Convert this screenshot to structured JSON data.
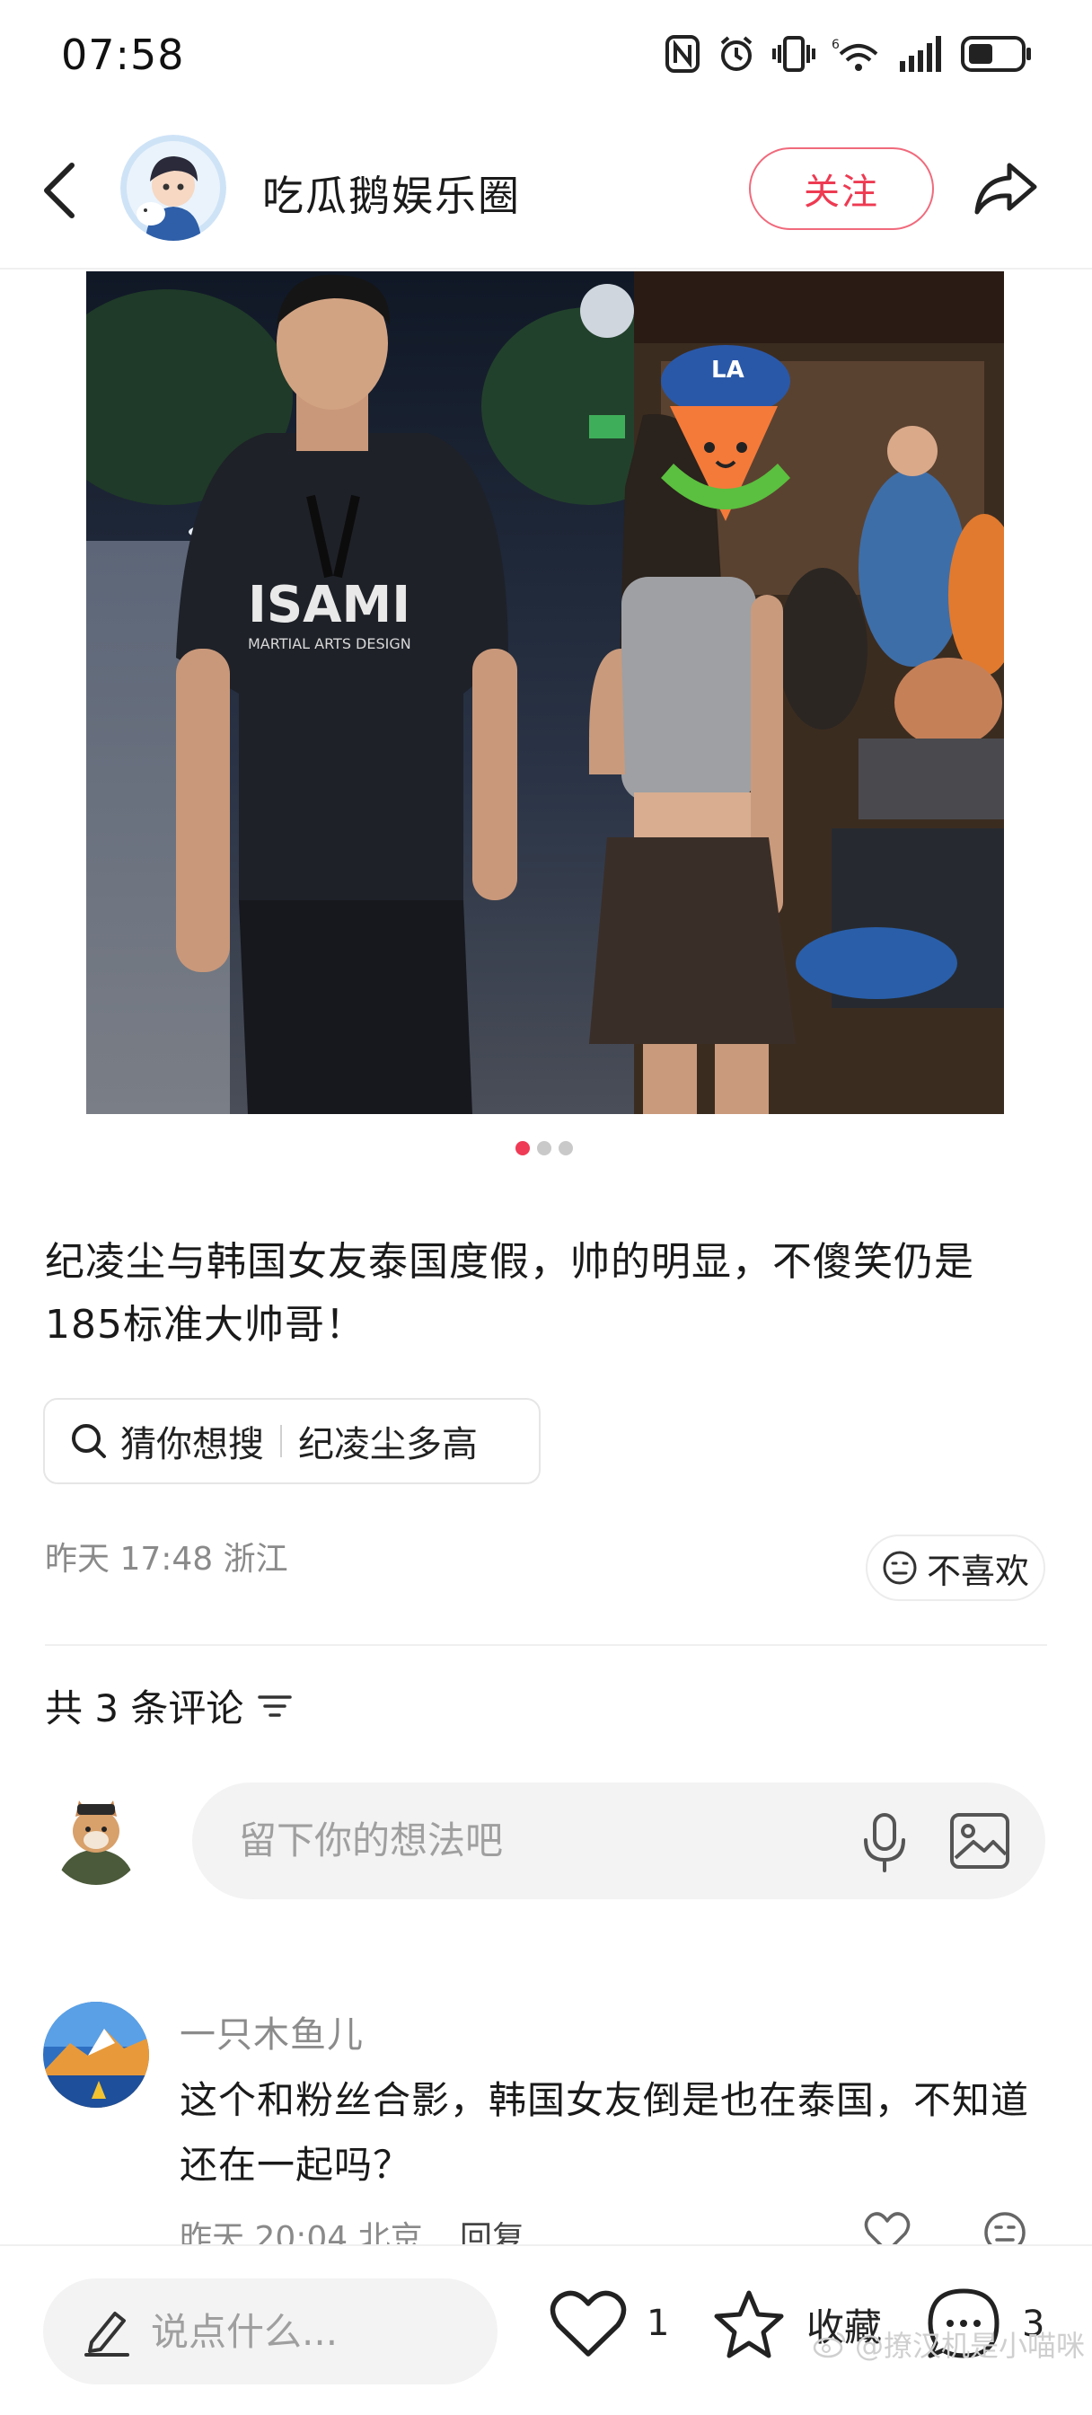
{
  "status_bar": {
    "time": "07:58",
    "icons": [
      "nfc-icon",
      "alarm-icon",
      "vibrate-icon",
      "wifi-6-icon",
      "signal-icon",
      "battery-icon"
    ]
  },
  "header": {
    "account_name": "吃瓜鹅娱乐圈",
    "follow_label": "关注"
  },
  "gallery": {
    "photo_shirt_text": "ISAMI",
    "photo_shirt_subtext": "MARTIAL ARTS DESIGN",
    "cap_text": "LA",
    "pages": 3,
    "active_page": 1
  },
  "post": {
    "text": "纪凌尘与韩国女友泰国度假，帅的明显，不傻笑仍是185标准大帅哥！",
    "search_prefix": "猜你想搜",
    "search_term": "纪凌尘多高",
    "meta": "昨天 17:48 浙江",
    "dislike_label": "不喜欢"
  },
  "comments": {
    "count_label": "共 3 条评论",
    "input_placeholder": "留下你的想法吧",
    "items": [
      {
        "user": "一只木鱼儿",
        "text": "这个和粉丝合影，韩国女友倒是也在泰国，不知道还在一起吗？",
        "meta": "昨天 20:04 北京",
        "reply_label": "回复"
      }
    ]
  },
  "bottom_bar": {
    "say_placeholder": "说点什么...",
    "like_count": "1",
    "favorite_label": "收藏",
    "comment_count": "3",
    "watermark": "@撩汉机是小喵咪"
  },
  "colors": {
    "accent": "#ef3b55",
    "follow_border": "#f06a7c",
    "muted_text": "#8a8a8a",
    "input_bg": "#f3f3f3"
  }
}
